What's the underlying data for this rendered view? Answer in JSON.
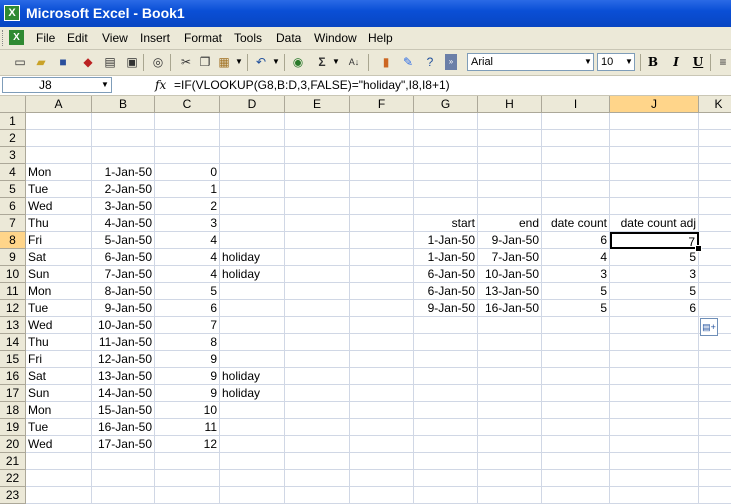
{
  "window": {
    "title": "Microsoft Excel - Book1"
  },
  "menu": [
    "File",
    "Edit",
    "View",
    "Insert",
    "Format",
    "Tools",
    "Data",
    "Window",
    "Help"
  ],
  "toolbar": {
    "font_name": "Arial",
    "font_size": "10",
    "bold": "B",
    "italic": "I",
    "underline": "U"
  },
  "formula_bar": {
    "cell_ref": "J8",
    "fx": "fx",
    "formula": "=IF(VLOOKUP(G8,B:D,3,FALSE)=\"holiday\",I8,I8+1)"
  },
  "columns": [
    "A",
    "B",
    "C",
    "D",
    "E",
    "F",
    "G",
    "H",
    "I",
    "J",
    "K"
  ],
  "rows": [
    "1",
    "2",
    "3",
    "4",
    "5",
    "6",
    "7",
    "8",
    "9",
    "10",
    "11",
    "12",
    "13",
    "14",
    "15",
    "16",
    "17",
    "18",
    "19",
    "20",
    "21",
    "22",
    "23"
  ],
  "cells": {
    "A4": "Mon",
    "B4": "1-Jan-50",
    "C4": "0",
    "A5": "Tue",
    "B5": "2-Jan-50",
    "C5": "1",
    "A6": "Wed",
    "B6": "3-Jan-50",
    "C6": "2",
    "A7": "Thu",
    "B7": "4-Jan-50",
    "C7": "3",
    "G7": "start",
    "H7": "end",
    "I7": "date count",
    "J7": "date count adj",
    "A8": "Fri",
    "B8": "5-Jan-50",
    "C8": "4",
    "G8": "1-Jan-50",
    "H8": "9-Jan-50",
    "I8": "6",
    "J8": "7",
    "A9": "Sat",
    "B9": "6-Jan-50",
    "C9": "4",
    "D9": "holiday",
    "G9": "1-Jan-50",
    "H9": "7-Jan-50",
    "I9": "4",
    "J9": "5",
    "A10": "Sun",
    "B10": "7-Jan-50",
    "C10": "4",
    "D10": "holiday",
    "G10": "6-Jan-50",
    "H10": "10-Jan-50",
    "I10": "3",
    "J10": "3",
    "A11": "Mon",
    "B11": "8-Jan-50",
    "C11": "5",
    "G11": "6-Jan-50",
    "H11": "13-Jan-50",
    "I11": "5",
    "J11": "5",
    "A12": "Tue",
    "B12": "9-Jan-50",
    "C12": "6",
    "G12": "9-Jan-50",
    "H12": "16-Jan-50",
    "I12": "5",
    "J12": "6",
    "A13": "Wed",
    "B13": "10-Jan-50",
    "C13": "7",
    "A14": "Thu",
    "B14": "11-Jan-50",
    "C14": "8",
    "A15": "Fri",
    "B15": "12-Jan-50",
    "C15": "9",
    "A16": "Sat",
    "B16": "13-Jan-50",
    "C16": "9",
    "D16": "holiday",
    "A17": "Sun",
    "B17": "14-Jan-50",
    "C17": "9",
    "D17": "holiday",
    "A18": "Mon",
    "B18": "15-Jan-50",
    "C18": "10",
    "A19": "Tue",
    "B19": "16-Jan-50",
    "C19": "11",
    "A20": "Wed",
    "B20": "17-Jan-50",
    "C20": "12"
  },
  "active_cell": "J8",
  "right_aligned_columns": [
    "B",
    "C",
    "G",
    "H",
    "I",
    "J"
  ]
}
